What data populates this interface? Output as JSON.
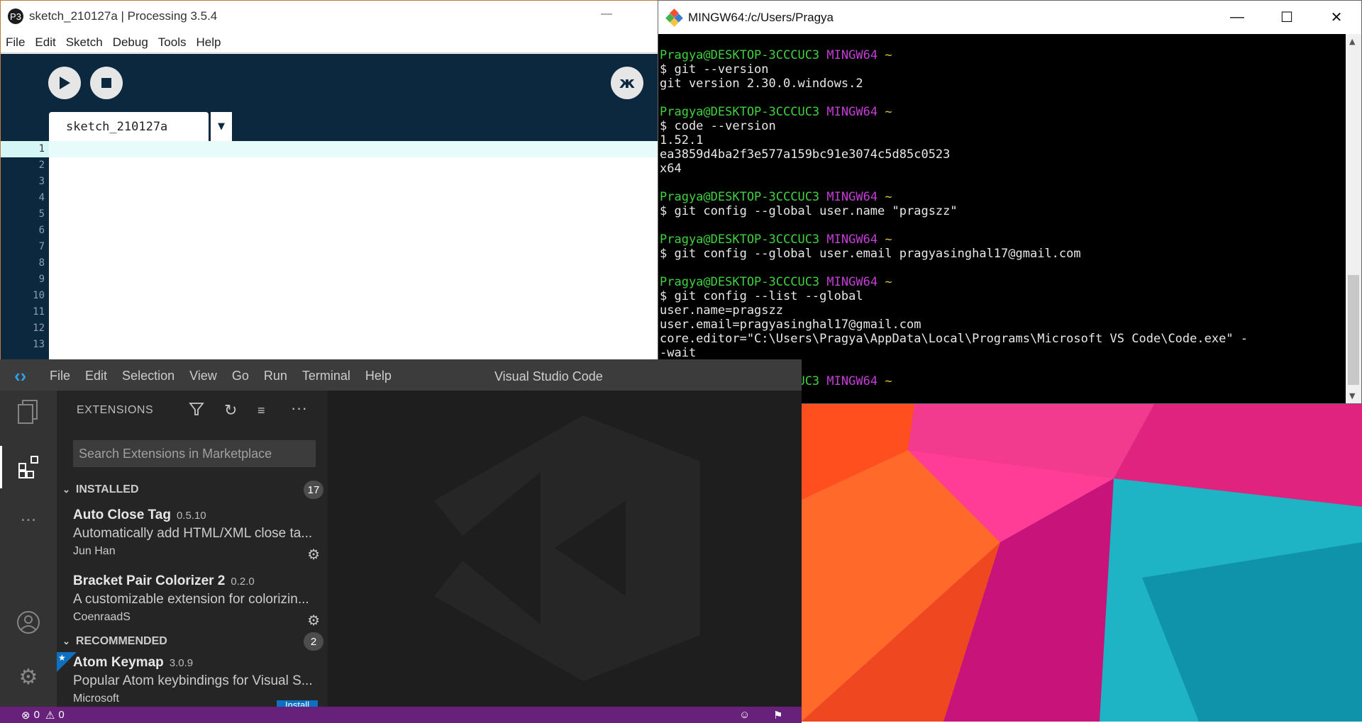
{
  "processing": {
    "title": "sketch_210127a | Processing 3.5.4",
    "menu": [
      "File",
      "Edit",
      "Sketch",
      "Debug",
      "Tools",
      "Help"
    ],
    "tab_label": "sketch_210127a",
    "line_numbers": [
      "1",
      "2",
      "3",
      "4",
      "5",
      "6",
      "7",
      "8",
      "9",
      "10",
      "11",
      "12",
      "13"
    ]
  },
  "terminal": {
    "title": "MINGW64:/c/Users/Pragya",
    "prompt_user": "Pragya@DESKTOP-3CCCUC3",
    "prompt_host": "MINGW64",
    "prompt_dir": "~",
    "blocks": [
      {
        "cmd": "$ git --version",
        "out": [
          "git version 2.30.0.windows.2"
        ]
      },
      {
        "cmd": "$ code --version",
        "out": [
          "1.52.1",
          "ea3859d4ba2f3e577a159bc91e3074c5d85c0523",
          "x64"
        ]
      },
      {
        "cmd": "$ git config --global user.name \"pragszz\"",
        "out": []
      },
      {
        "cmd": "$ git config --global user.email pragyasinghal17@gmail.com",
        "out": []
      },
      {
        "cmd": "$ git config --list --global",
        "out": [
          "user.name=pragszz",
          "user.email=pragyasinghal17@gmail.com",
          "core.editor=\"C:\\Users\\Pragya\\AppData\\Local\\Programs\\Microsoft VS Code\\Code.exe\" -",
          "-wait"
        ]
      }
    ],
    "final_prompt": "$"
  },
  "vscode": {
    "menu": [
      "File",
      "Edit",
      "Selection",
      "View",
      "Go",
      "Run",
      "Terminal",
      "Help"
    ],
    "window_title": "Visual Studio Code",
    "extensions_header": "EXTENSIONS",
    "search_placeholder": "Search Extensions in Marketplace",
    "installed_label": "INSTALLED",
    "installed_count": "17",
    "recommended_label": "RECOMMENDED",
    "recommended_count": "2",
    "installed": [
      {
        "name": "Auto Close Tag",
        "version": "0.5.10",
        "desc": "Automatically add HTML/XML close ta...",
        "publisher": "Jun Han"
      },
      {
        "name": "Bracket Pair Colorizer 2",
        "version": "0.2.0",
        "desc": "A customizable extension for colorizin...",
        "publisher": "CoenraadS"
      }
    ],
    "recommended": [
      {
        "name": "Atom Keymap",
        "version": "3.0.9",
        "desc": "Popular Atom keybindings for Visual S...",
        "publisher": "Microsoft",
        "install": "Install"
      }
    ],
    "status": {
      "errors": "0",
      "warnings": "0"
    }
  }
}
